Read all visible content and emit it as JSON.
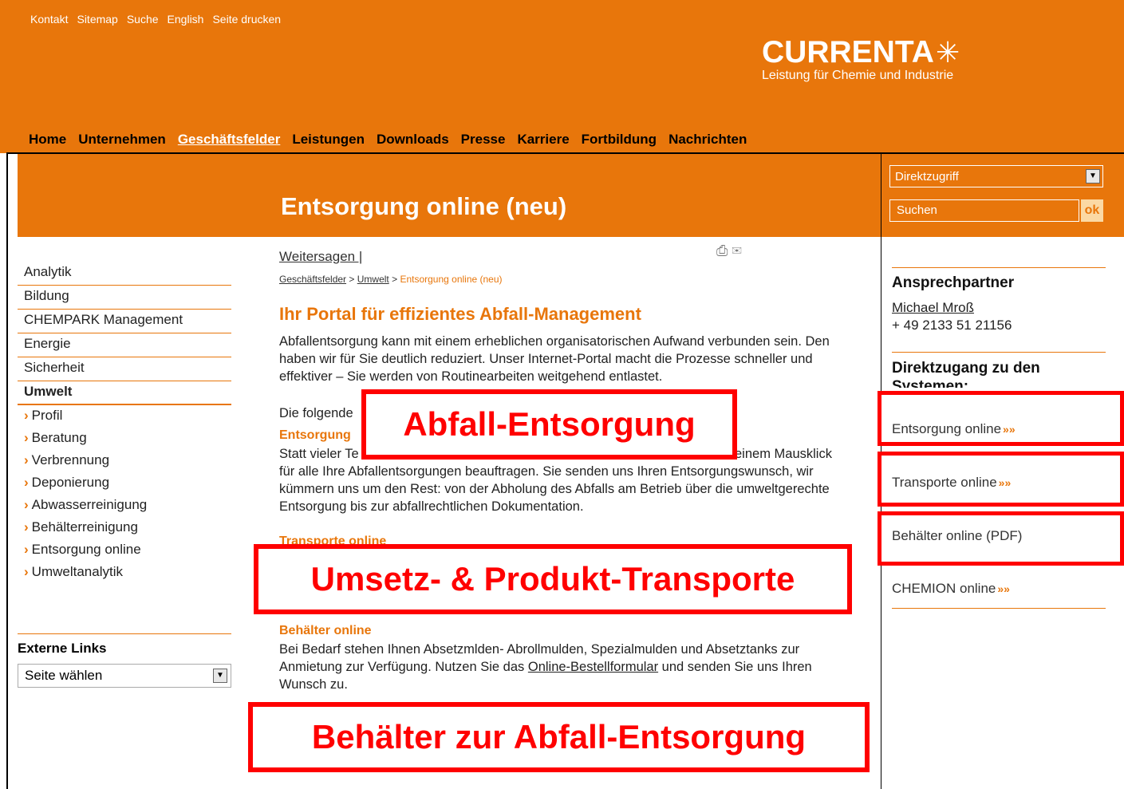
{
  "top_links": [
    "Kontakt",
    "Sitemap",
    "Suche",
    "English",
    "Seite drucken"
  ],
  "logo": {
    "word": "CURRENTA",
    "tagline": "Leistung für Chemie und Industrie"
  },
  "main_nav": {
    "items": [
      "Home",
      "Unternehmen",
      "Geschäftsfelder",
      "Leistungen",
      "Downloads",
      "Presse",
      "Karriere",
      "Fortbildung",
      "Nachrichten"
    ],
    "active": "Geschäftsfelder"
  },
  "banner_title": "Entsorgung online (neu)",
  "search": {
    "direkt_label": "Direktzugriff",
    "placeholder": "Suchen",
    "ok_label": "ok"
  },
  "left_nav": {
    "items": [
      "Analytik",
      "Bildung",
      "CHEMPARK Management",
      "Energie",
      "Sicherheit",
      "Umwelt"
    ],
    "sub_items": [
      "Profil",
      "Beratung",
      "Verbrennung",
      "Deponierung",
      "Abwasserreinigung",
      "Behälterreinigung",
      "Entsorgung online",
      "Umweltanalytik"
    ]
  },
  "external": {
    "title": "Externe Links",
    "select_value": "Seite wählen"
  },
  "content": {
    "weitersagen": "Weitersagen |",
    "breadcrumb": [
      "Geschäftsfelder",
      "Umwelt",
      "Entsorgung online (neu)"
    ],
    "heading": "Ihr Portal für effizientes Abfall-Management",
    "intro": "Abfallentsorgung kann mit einem erheblichen organisatorischen Aufwand verbunden sein. Den haben wir für Sie deutlich reduziert. Unser Internet-Portal macht die Prozesse schneller und effektiver – Sie werden von Routinearbeiten weitgehend entlastet.",
    "die_folgende": "Die folgende",
    "entsorgung_title": "Entsorgung",
    "entsorgung_line1a": "Statt vieler Te",
    "entsorgung_line1b": "einem Mausklick",
    "entsorgung_rest": "für alle Ihre Abfallentsorgungen beauftragen. Sie senden uns Ihren Entsorgungswunsch, wir kümmern uns um den Rest: von der Abholung des Abfalls am Betrieb über die umweltgerechte Entsorgung bis zur abfallrechtlichen Dokumentation.",
    "transporte_title": "Transporte online",
    "behaelter_title": "Behälter online",
    "behaelter_text_a": "Bei Bedarf stehen Ihnen Absetzmlden- Abrollmulden, Spezialmulden und Absetztanks zur Anmietung zur Verfügung. Nutzen Sie das ",
    "behaelter_link": "Online-Bestellformular",
    "behaelter_text_b": " und senden Sie uns Ihren Wunsch zu."
  },
  "right": {
    "contact_head": "Ansprechpartner",
    "contact_name": "Michael Mroß",
    "contact_phone": "+ 49 2133 51 21156",
    "systems_head": "Direktzugang zu den Systemen:",
    "links": [
      "Entsorgung online",
      "Transporte online",
      "Behälter online (PDF)",
      "CHEMION online"
    ],
    "more_glyph": "»»"
  },
  "overlays": [
    "Abfall-Entsorgung",
    "Umsetz- & Produkt-Transporte",
    "Behälter zur Abfall-Entsorgung"
  ],
  "colors": {
    "brand_orange": "#e8760b",
    "annotation_red": "#ff0000"
  }
}
